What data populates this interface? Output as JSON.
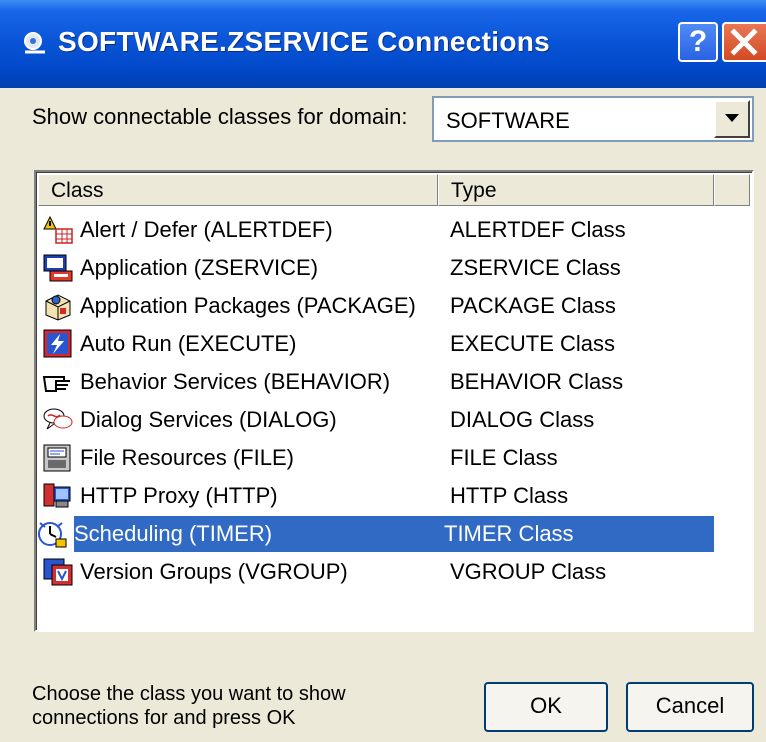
{
  "window": {
    "title": "SOFTWARE.ZSERVICE Connections",
    "help_label": "?",
    "icon": "connections-app-icon"
  },
  "domain": {
    "label": "Show connectable classes for domain:",
    "selected": "SOFTWARE"
  },
  "list": {
    "columns": [
      "Class",
      "Type",
      ""
    ],
    "rows": [
      {
        "name": "Alert / Defer (ALERTDEF)",
        "type": "ALERTDEF Class",
        "icon": "alert-defer-icon"
      },
      {
        "name": "Application (ZSERVICE)",
        "type": "ZSERVICE Class",
        "icon": "application-icon"
      },
      {
        "name": "Application Packages (PACKAGE)",
        "type": "PACKAGE Class",
        "icon": "package-icon"
      },
      {
        "name": "Auto Run (EXECUTE)",
        "type": "EXECUTE Class",
        "icon": "auto-run-icon"
      },
      {
        "name": "Behavior Services (BEHAVIOR)",
        "type": "BEHAVIOR Class",
        "icon": "behavior-hand-icon"
      },
      {
        "name": "Dialog Services (DIALOG)",
        "type": "DIALOG Class",
        "icon": "dialog-icon"
      },
      {
        "name": "File Resources (FILE)",
        "type": "FILE Class",
        "icon": "file-resources-icon"
      },
      {
        "name": "HTTP Proxy (HTTP)",
        "type": "HTTP Class",
        "icon": "http-proxy-icon"
      },
      {
        "name": "Scheduling (TIMER)",
        "type": "TIMER Class",
        "icon": "scheduling-icon"
      },
      {
        "name": "Version Groups (VGROUP)",
        "type": "VGROUP Class",
        "icon": "version-groups-icon"
      }
    ],
    "selected_index": 8
  },
  "footer": {
    "hint": "Choose the class you want to show connections for and press OK",
    "ok_label": "OK",
    "cancel_label": "Cancel"
  },
  "colors": {
    "title_bar": "#0a55d8",
    "selection": "#316ac5",
    "dialog_bg": "#ece9d8"
  }
}
